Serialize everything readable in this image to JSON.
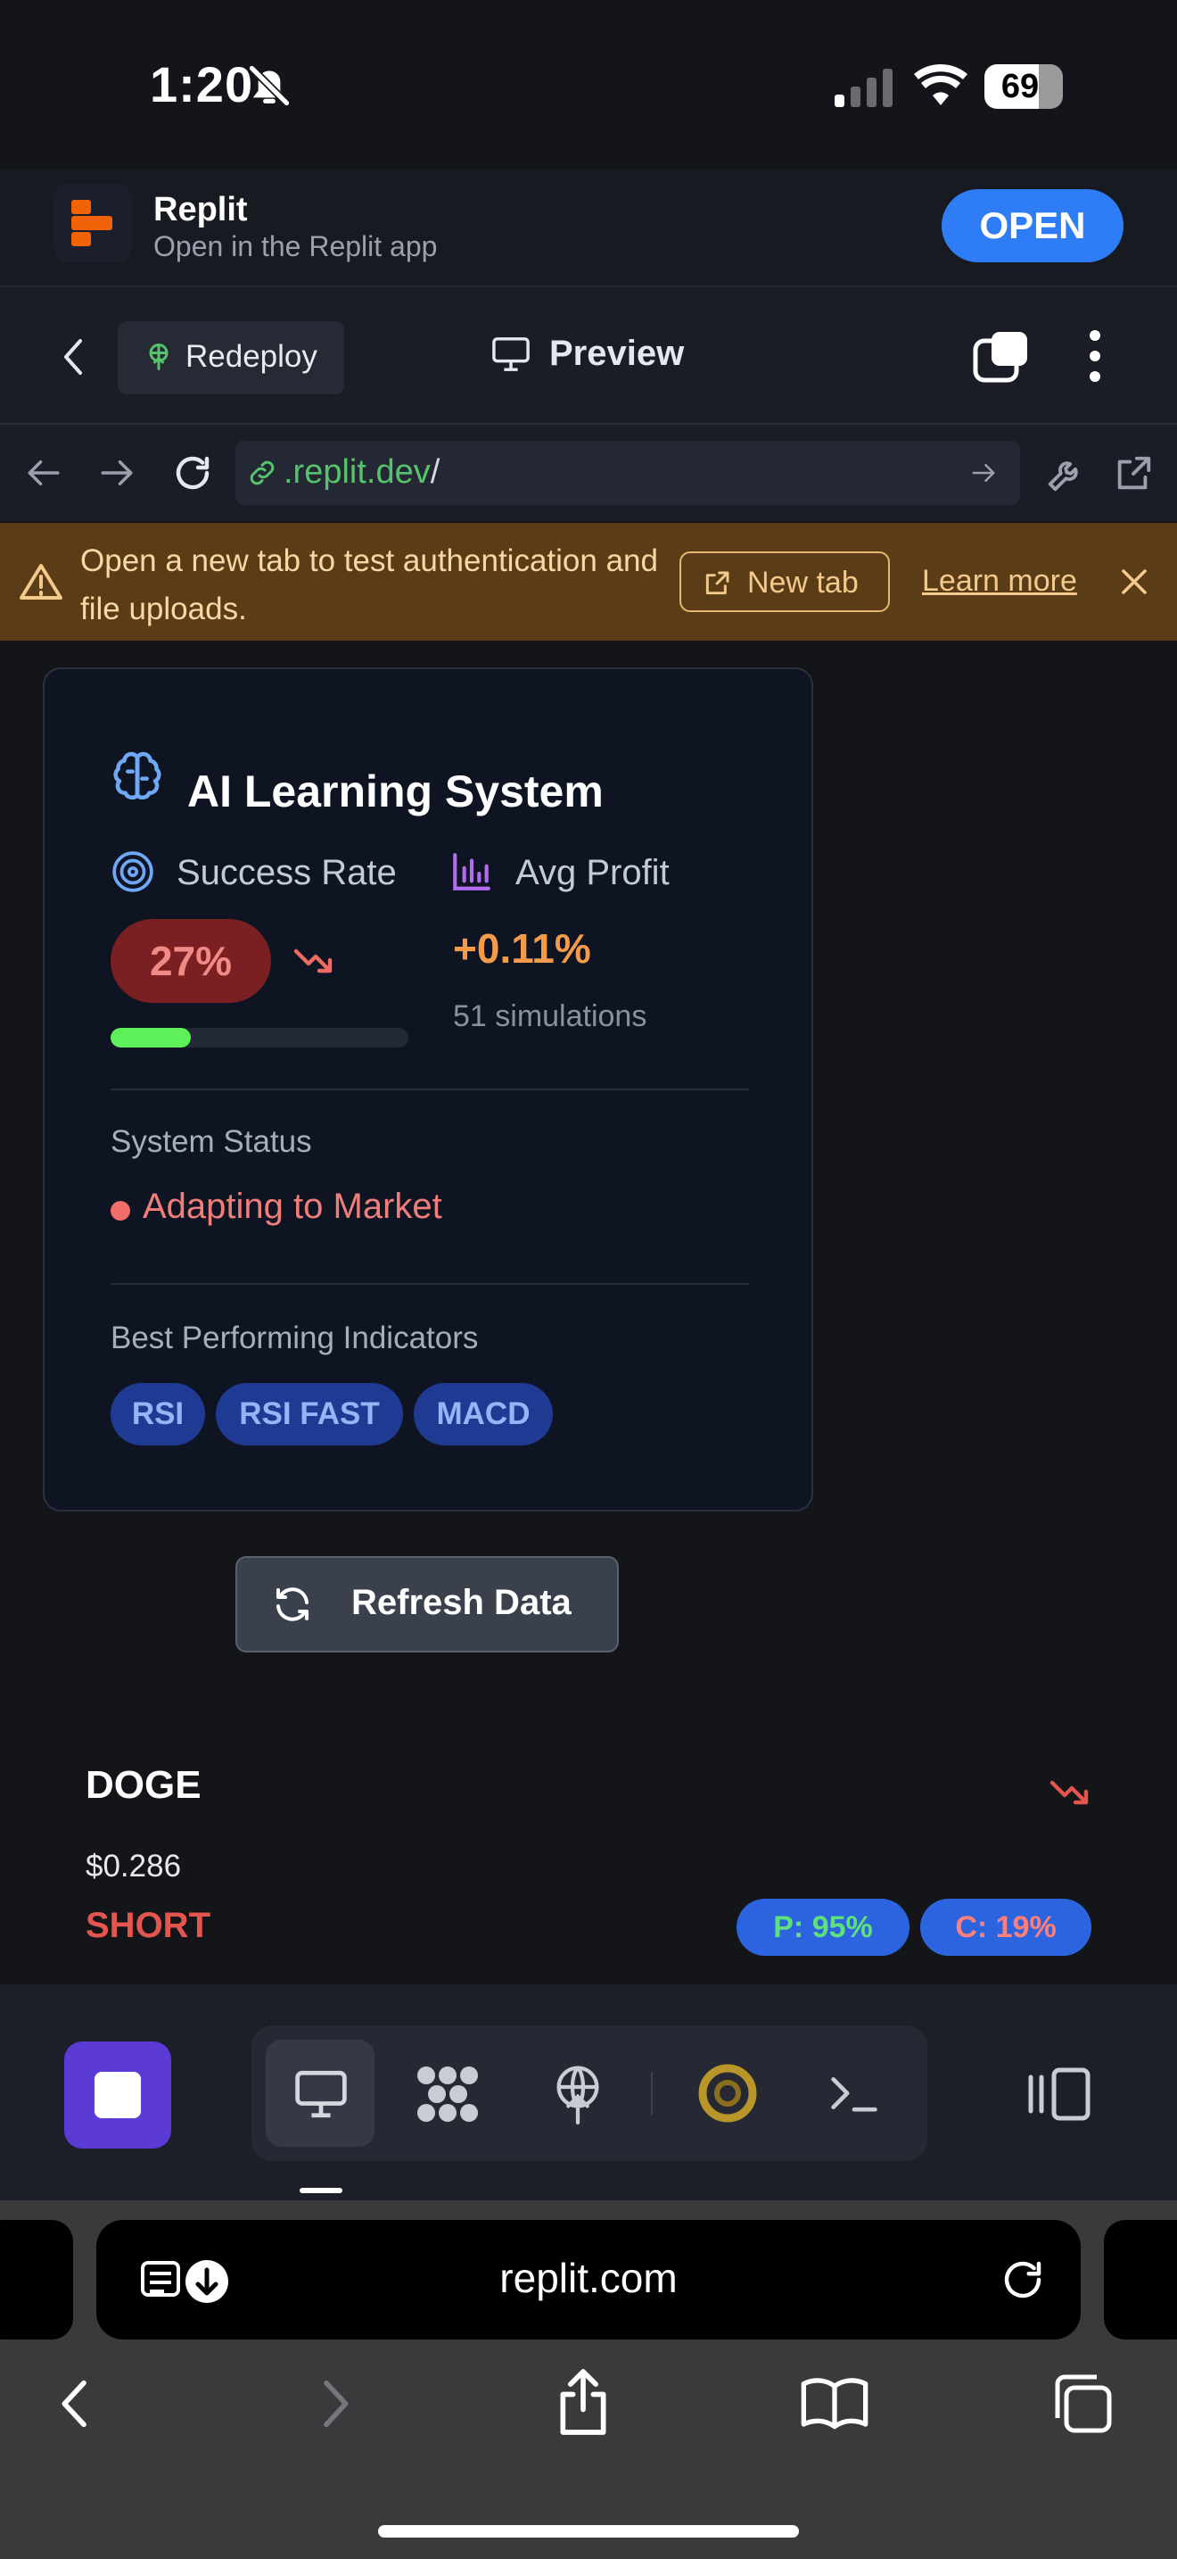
{
  "status_bar": {
    "time": "1:20",
    "battery": "69"
  },
  "app_banner": {
    "name": "Replit",
    "subtitle": "Open in the Replit app",
    "open_label": "OPEN"
  },
  "toolbar": {
    "redeploy_label": "Redeploy",
    "preview_label": "Preview"
  },
  "url_bar": {
    "url_domain": ".replit.dev",
    "url_path": "/"
  },
  "warning": {
    "message": "Open a new tab to test authentication and file uploads.",
    "new_tab_label": "New tab",
    "learn_more_label": "Learn more"
  },
  "ai_card": {
    "title": "AI Learning System",
    "success_rate_label": "Success Rate",
    "success_rate": "27%",
    "success_progress": 0.27,
    "avg_profit_label": "Avg Profit",
    "avg_profit": "+0.11%",
    "simulations": "51 simulations",
    "system_status_label": "System Status",
    "system_status": "Adapting to Market",
    "indicators_label": "Best Performing Indicators",
    "indicators": [
      "RSI",
      "RSI FAST",
      "MACD"
    ]
  },
  "refresh_label": "Refresh Data",
  "trade_card": {
    "symbol": "DOGE",
    "price": "$0.286",
    "side": "SHORT",
    "p_chip": "P: 95%",
    "c_chip": "C: 19%"
  },
  "safari": {
    "address": "replit.com"
  },
  "colors": {
    "accent_blue": "#2f7df6",
    "replit_purple": "#5b3ad6",
    "warning_bg": "#5a3c16",
    "success_pill": "#7a1f22",
    "profit_orange": "#f39b4a",
    "short_red": "#e5554f"
  }
}
